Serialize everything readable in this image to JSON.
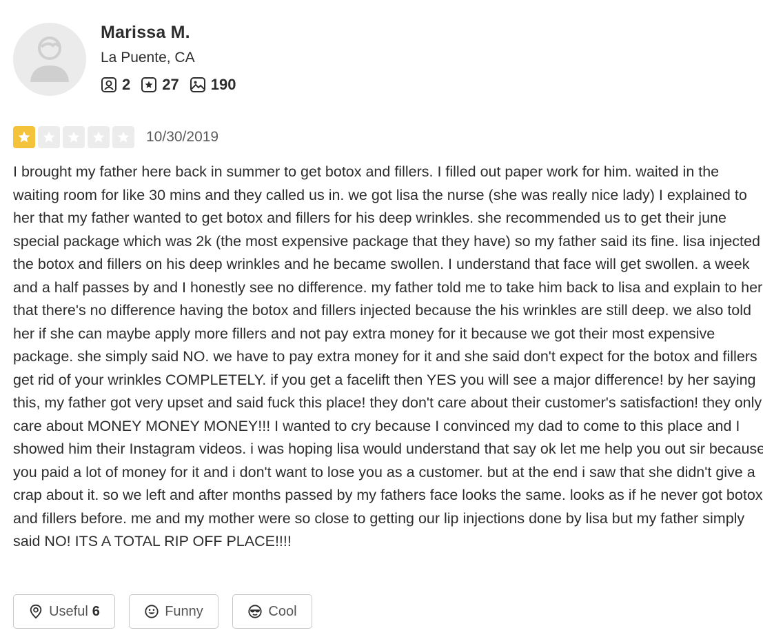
{
  "user": {
    "name": "Marissa M.",
    "location": "La Puente, CA",
    "stats": {
      "friends": "2",
      "reviews": "27",
      "photos": "190"
    },
    "avatar_icon": "default-user-icon"
  },
  "review": {
    "rating": 1,
    "rating_max": 5,
    "date": "10/30/2019",
    "text": "I brought my father here back in summer to get botox and fillers. I filled out paper work for him. waited in the waiting room for like 30 mins and they called us in. we got lisa the nurse (she was really nice lady) I explained to her that my father wanted to get botox and fillers for his deep wrinkles. she recommended us to get their june special package which was 2k (the most expensive package that they have) so my father said its fine. lisa injected the botox and fillers on his deep wrinkles and he became swollen. I understand that face will get swollen. a week and a half passes by and I honestly see no difference. my father told me to take him back to lisa and explain to her that there's no difference having the botox and fillers injected because the his wrinkles are still deep. we also told her if she can maybe apply more fillers and not pay extra money for it because we got their most expensive package. she simply said NO. we have to pay extra money for it and she said don't expect for the botox and fillers get rid of your wrinkles COMPLETELY. if you get a facelift then YES you will see a major difference! by her saying this, my father got very upset and said fuck this place! they don't care about their customer's satisfaction! they only care about MONEY MONEY MONEY!!! I wanted to cry because I convinced my dad to come to this place and I showed him their Instagram videos. i was hoping lisa would understand that say ok let me help you out sir because you paid a lot of money for it and i don't want to lose you as a customer. but at the end i saw that she didn't give a crap about it. so we left and after months passed by my fathers face looks the same. looks as if he never got botox and fillers before. me and my mother were so close to getting our lip injections done by lisa but my father simply said NO! ITS A TOTAL RIP OFF PLACE!!!!"
  },
  "reactions": {
    "useful": {
      "label": "Useful",
      "count": "6",
      "icon": "lightbulb-icon"
    },
    "funny": {
      "label": "Funny",
      "icon": "smile-icon"
    },
    "cool": {
      "label": "Cool",
      "icon": "sunglasses-icon"
    }
  },
  "colors": {
    "star_active": "#f4c33a",
    "star_inactive": "#ececec",
    "text": "#2d2d2d"
  }
}
